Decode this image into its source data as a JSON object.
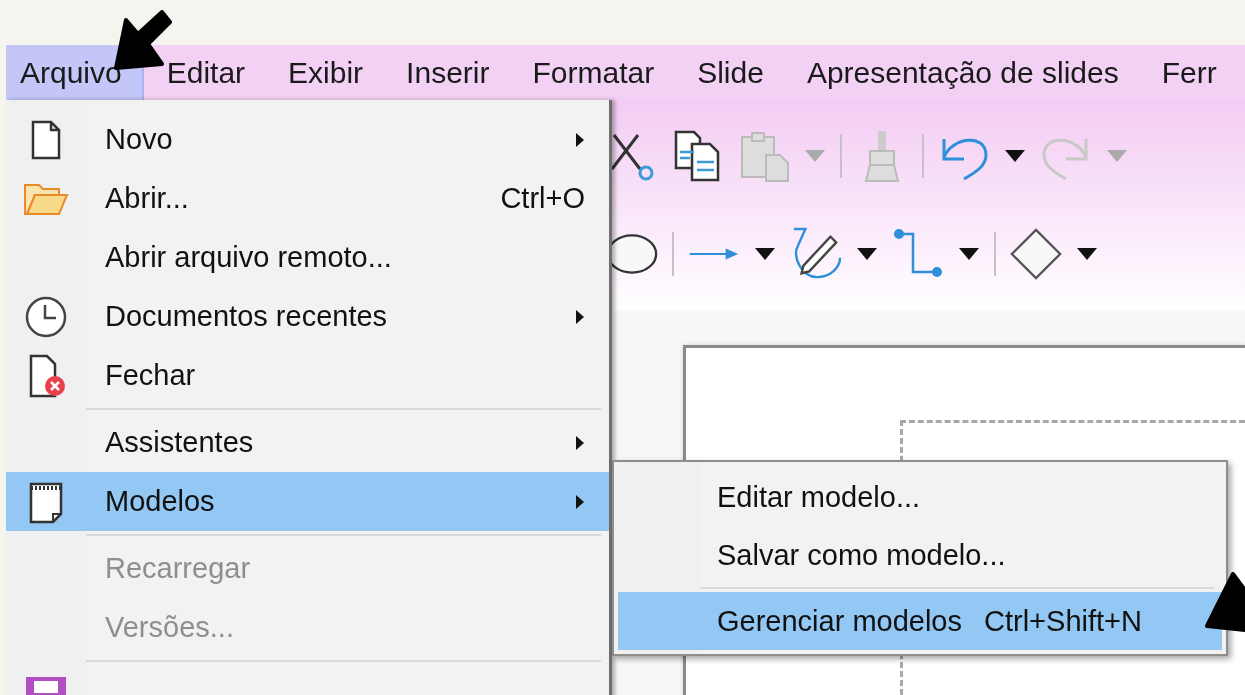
{
  "menubar": {
    "items": [
      {
        "label": "Arquivo",
        "selected": true
      },
      {
        "label": "Editar",
        "selected": false
      },
      {
        "label": "Exibir",
        "selected": false
      },
      {
        "label": "Inserir",
        "selected": false
      },
      {
        "label": "Formatar",
        "selected": false
      },
      {
        "label": "Slide",
        "selected": false
      },
      {
        "label": "Apresentação de slides",
        "selected": false
      },
      {
        "label": "Ferr",
        "selected": false
      }
    ]
  },
  "file_menu": {
    "items": [
      {
        "kind": "item",
        "label": "Novo",
        "submenu": true,
        "selected": false,
        "disabled": false
      },
      {
        "kind": "item",
        "label": "Abrir...",
        "shortcut": "Ctrl+O",
        "submenu": false,
        "selected": false,
        "disabled": false
      },
      {
        "kind": "item",
        "label": "Abrir arquivo remoto...",
        "submenu": false,
        "selected": false,
        "disabled": false
      },
      {
        "kind": "item",
        "label": "Documentos recentes",
        "submenu": true,
        "selected": false,
        "disabled": false
      },
      {
        "kind": "item",
        "label": "Fechar",
        "submenu": false,
        "selected": false,
        "disabled": false
      },
      {
        "kind": "separator"
      },
      {
        "kind": "item",
        "label": "Assistentes",
        "submenu": true,
        "selected": false,
        "disabled": false
      },
      {
        "kind": "item",
        "label": "Modelos",
        "submenu": true,
        "selected": true,
        "disabled": false
      },
      {
        "kind": "separator"
      },
      {
        "kind": "item",
        "label": "Recarregar",
        "submenu": false,
        "selected": false,
        "disabled": true
      },
      {
        "kind": "item",
        "label": "Versões...",
        "submenu": false,
        "selected": false,
        "disabled": true
      },
      {
        "kind": "separator"
      },
      {
        "kind": "item",
        "selected": false
      }
    ]
  },
  "templates_submenu": {
    "items": [
      {
        "kind": "item",
        "label": "Editar modelo...",
        "selected": false
      },
      {
        "kind": "item",
        "label": "Salvar como modelo...",
        "selected": false
      },
      {
        "kind": "separator"
      },
      {
        "kind": "item",
        "label": "Gerenciar modelos",
        "shortcut": "Ctrl+Shift+N",
        "selected": true
      }
    ]
  }
}
